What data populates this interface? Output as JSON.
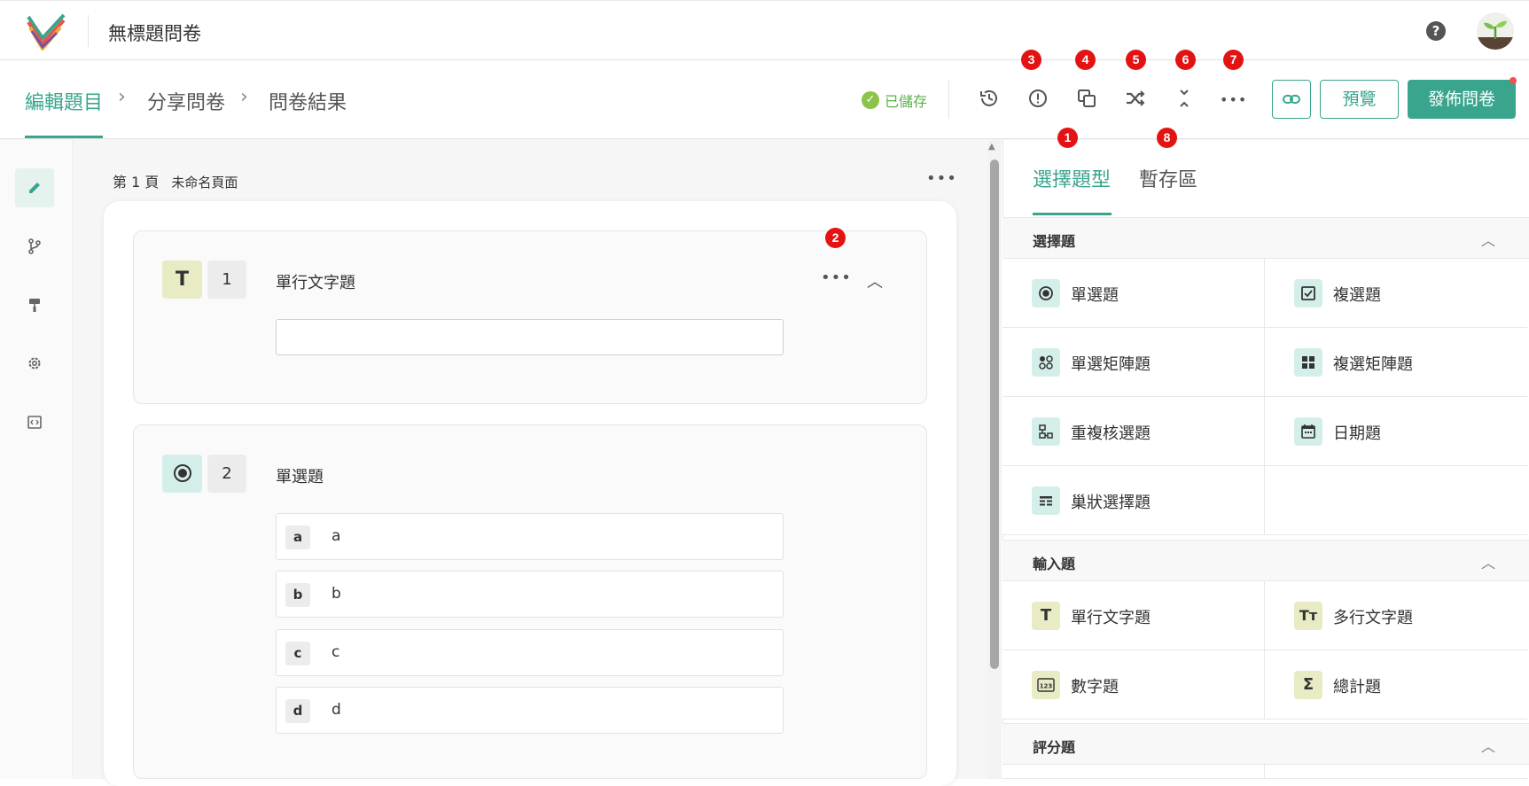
{
  "app": {
    "doc_title": "無標題問卷",
    "help_label": "?"
  },
  "steps": [
    {
      "label": "編輯題目"
    },
    {
      "label": "分享問卷"
    },
    {
      "label": "問卷結果"
    }
  ],
  "toolbar": {
    "saved_label": "已儲存",
    "preview_label": "預覽",
    "publish_label": "發佈問卷",
    "tools": [
      "history-icon",
      "alert-icon",
      "copy-icon",
      "shuffle-icon",
      "collapse-icon",
      "more-icon"
    ]
  },
  "badges": [
    "1",
    "2",
    "3",
    "4",
    "5",
    "6",
    "7",
    "8"
  ],
  "rail": [
    "pencil-icon",
    "branch-icon",
    "paint-roller-icon",
    "gear-icon",
    "code-icon"
  ],
  "page": {
    "number_label": "第 1 頁",
    "name": "未命名頁面"
  },
  "questions": [
    {
      "icon": "T",
      "number": "1",
      "title": "單行文字題"
    },
    {
      "icon": "radio",
      "number": "2",
      "title": "單選題",
      "options": [
        {
          "key": "a",
          "value": "a"
        },
        {
          "key": "b",
          "value": "b"
        },
        {
          "key": "c",
          "value": "c"
        },
        {
          "key": "d",
          "value": "d"
        }
      ]
    }
  ],
  "panel": {
    "tabs": [
      {
        "label": "選擇題型"
      },
      {
        "label": "暫存區"
      }
    ],
    "sections": [
      {
        "title": "選擇題",
        "types": [
          "單選題",
          "複選題",
          "單選矩陣題",
          "複選矩陣題",
          "重複核選題",
          "日期題",
          "巢狀選擇題"
        ]
      },
      {
        "title": "輸入題",
        "types": [
          "單行文字題",
          "多行文字題",
          "數字題",
          "總計題"
        ]
      },
      {
        "title": "評分題"
      }
    ]
  },
  "colors": {
    "accent": "#3aa58d",
    "badge": "#e41313",
    "saved": "#59b14a"
  }
}
